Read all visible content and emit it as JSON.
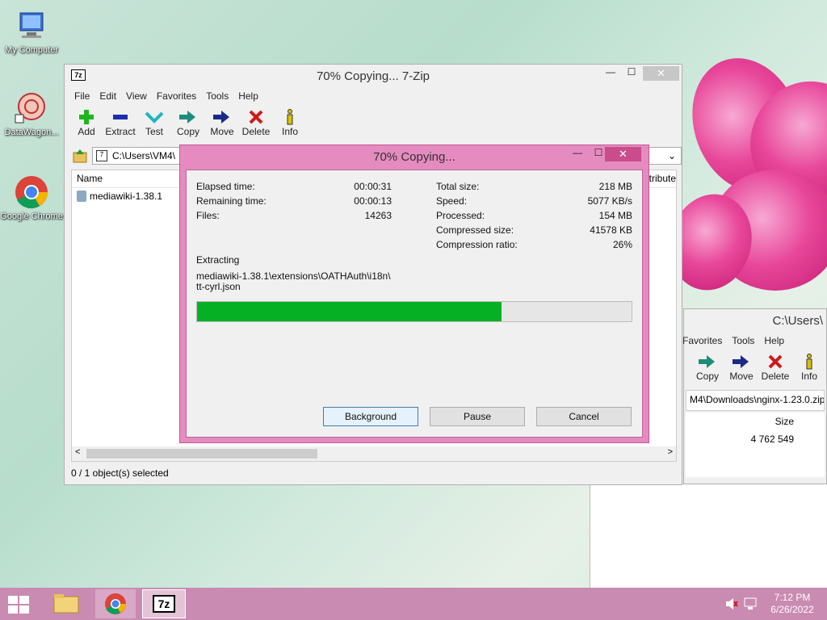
{
  "desktop": {
    "icons": [
      {
        "label": "My Computer",
        "icon": "computer-icon"
      },
      {
        "label": "DataWagon...",
        "icon": "datawagon-icon"
      },
      {
        "label": "Google Chrome",
        "icon": "chrome-icon"
      }
    ]
  },
  "main_window": {
    "title": "70% Copying... 7-Zip",
    "menu": [
      "File",
      "Edit",
      "View",
      "Favorites",
      "Tools",
      "Help"
    ],
    "toolbar": [
      {
        "label": "Add",
        "icon": "plus-icon",
        "color": "#1fb51f"
      },
      {
        "label": "Extract",
        "icon": "minus-icon",
        "color": "#1a2fb0"
      },
      {
        "label": "Test",
        "icon": "check-icon",
        "color": "#1bb5c0"
      },
      {
        "label": "Copy",
        "icon": "copy-arrow-icon",
        "color": "#1e8c7a"
      },
      {
        "label": "Move",
        "icon": "move-arrow-icon",
        "color": "#1a2a8a"
      },
      {
        "label": "Delete",
        "icon": "delete-x-icon",
        "color": "#d01818"
      },
      {
        "label": "Info",
        "icon": "info-icon",
        "color": "#d8c000"
      }
    ],
    "path": "C:\\Users\\VM4\\",
    "column_name": "Name",
    "column_attributes": "ttribute",
    "file": "mediawiki-1.38.1",
    "status": "0 / 1 object(s) selected"
  },
  "back_window": {
    "title": "C:\\Users\\",
    "menu": [
      "Favorites",
      "Tools",
      "Help"
    ],
    "toolbar": [
      {
        "label": "Copy",
        "icon": "copy-arrow-icon"
      },
      {
        "label": "Move",
        "icon": "move-arrow-icon"
      },
      {
        "label": "Delete",
        "icon": "delete-x-icon"
      },
      {
        "label": "Info",
        "icon": "info-icon"
      }
    ],
    "path": "M4\\Downloads\\nginx-1.23.0.zip\\",
    "column_size": "Size",
    "size_value": "4 762 549"
  },
  "dialog": {
    "title": "70% Copying...",
    "progress": 0.7,
    "left_labels": [
      "Elapsed time:",
      "Remaining time:",
      "Files:"
    ],
    "left_values": [
      "00:00:31",
      "00:00:13",
      "14263"
    ],
    "right_labels": [
      "Total size:",
      "Speed:",
      "Processed:",
      "Compressed size:",
      "Compression ratio:"
    ],
    "right_values": [
      "218 MB",
      "5077 KB/s",
      "154 MB",
      "41578 KB",
      "26%"
    ],
    "operation": "Extracting",
    "current_file_line1": "mediawiki-1.38.1\\extensions\\OATHAuth\\i18n\\",
    "current_file_line2": "tt-cyrl.json",
    "buttons": {
      "background": "Background",
      "pause": "Pause",
      "cancel": "Cancel"
    },
    "progress_color": "#06b025"
  },
  "taskbar": {
    "time": "7:12 PM",
    "date": "6/26/2022"
  }
}
